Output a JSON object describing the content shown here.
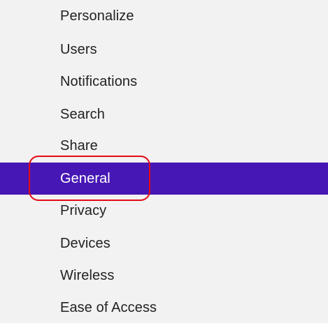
{
  "menu": {
    "items": [
      {
        "label": "Personalize",
        "selected": false
      },
      {
        "label": "Users",
        "selected": false
      },
      {
        "label": "Notifications",
        "selected": false
      },
      {
        "label": "Search",
        "selected": false
      },
      {
        "label": "Share",
        "selected": false
      },
      {
        "label": "General",
        "selected": true
      },
      {
        "label": "Privacy",
        "selected": false
      },
      {
        "label": "Devices",
        "selected": false
      },
      {
        "label": "Wireless",
        "selected": false
      },
      {
        "label": "Ease of Access",
        "selected": false
      }
    ]
  },
  "colors": {
    "background": "#f2f2f2",
    "selected_background": "#4617b4",
    "text": "#222222",
    "selected_text": "#ffffff",
    "highlight_outline": "#e50914"
  }
}
